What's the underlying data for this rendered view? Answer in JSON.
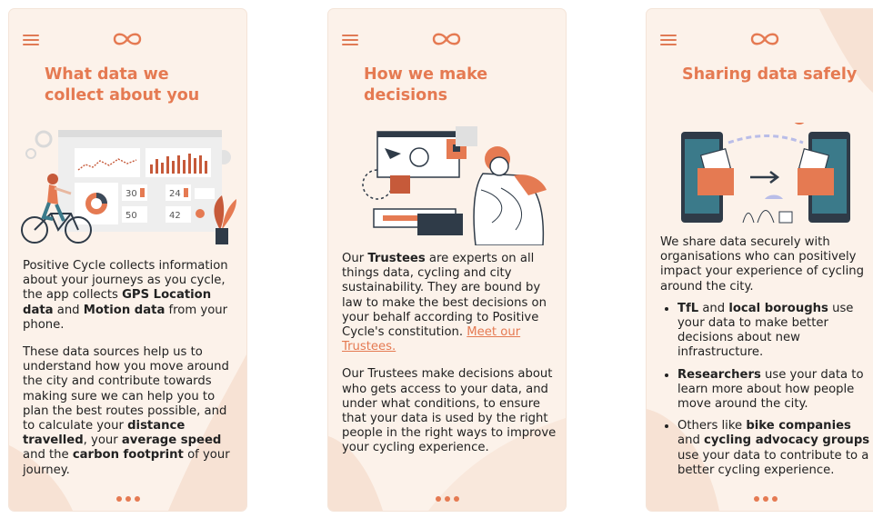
{
  "accent": "#e57a52",
  "panel_bg": "#fcf2ea",
  "icons": {
    "menu": "hamburger-menu-icon",
    "logo": "infinity-cycle-logo-icon"
  },
  "panels": [
    {
      "title": "What data we collect about you",
      "illustration": "cyclist-dashboard-illustration",
      "dashboard_numbers": [
        "30",
        "24",
        "50",
        "42"
      ],
      "p1": {
        "t1": "Positive Cycle collects information about your journeys as you cycle, the app collects ",
        "b1": "GPS Location data",
        "t2": " and ",
        "b2": "Motion data",
        "t3": " from your phone."
      },
      "p2": {
        "t1": "These data sources help us to understand how you move around the city and contribute towards making sure we can help you to plan the best routes possible, and to calculate your ",
        "b1": "distance travelled",
        "t2": ", your ",
        "b2": "average speed",
        "t3": " and the ",
        "b3": "carbon footprint",
        "t4": " of your journey."
      }
    },
    {
      "title": "How we make decisions",
      "illustration": "trustees-decision-illustration",
      "p1": {
        "t1": "Our ",
        "b1": "Trustees",
        "t2": " are experts on all things data, cycling and city sustainability. They are bound by law to make the best decisions on your behalf according to Positive Cycle's constitution. ",
        "link": "Meet our Trustees."
      },
      "p2": "Our Trustees make decisions about who gets access to your data, and under what conditions, to ensure that your data is used by the right people in the right ways to improve your cycling experience."
    },
    {
      "title": "Sharing data safely",
      "illustration": "secure-data-transfer-illustration",
      "intro": "We share data securely with organisations who can positively impact your experience of cycling around the city.",
      "bullets": [
        {
          "b1": "TfL",
          "t1": " and ",
          "b2": "local boroughs",
          "t2": " use your data to make better decisions about new infrastructure."
        },
        {
          "b1": "Researchers",
          "t1": " use your data to learn more about how people move around the city."
        },
        {
          "t0": "Others like ",
          "b1": "bike companies",
          "t1": " and ",
          "b2": "cycling advocacy groups",
          "t2": " use your data to contribute to a better cycling experience."
        }
      ]
    }
  ]
}
